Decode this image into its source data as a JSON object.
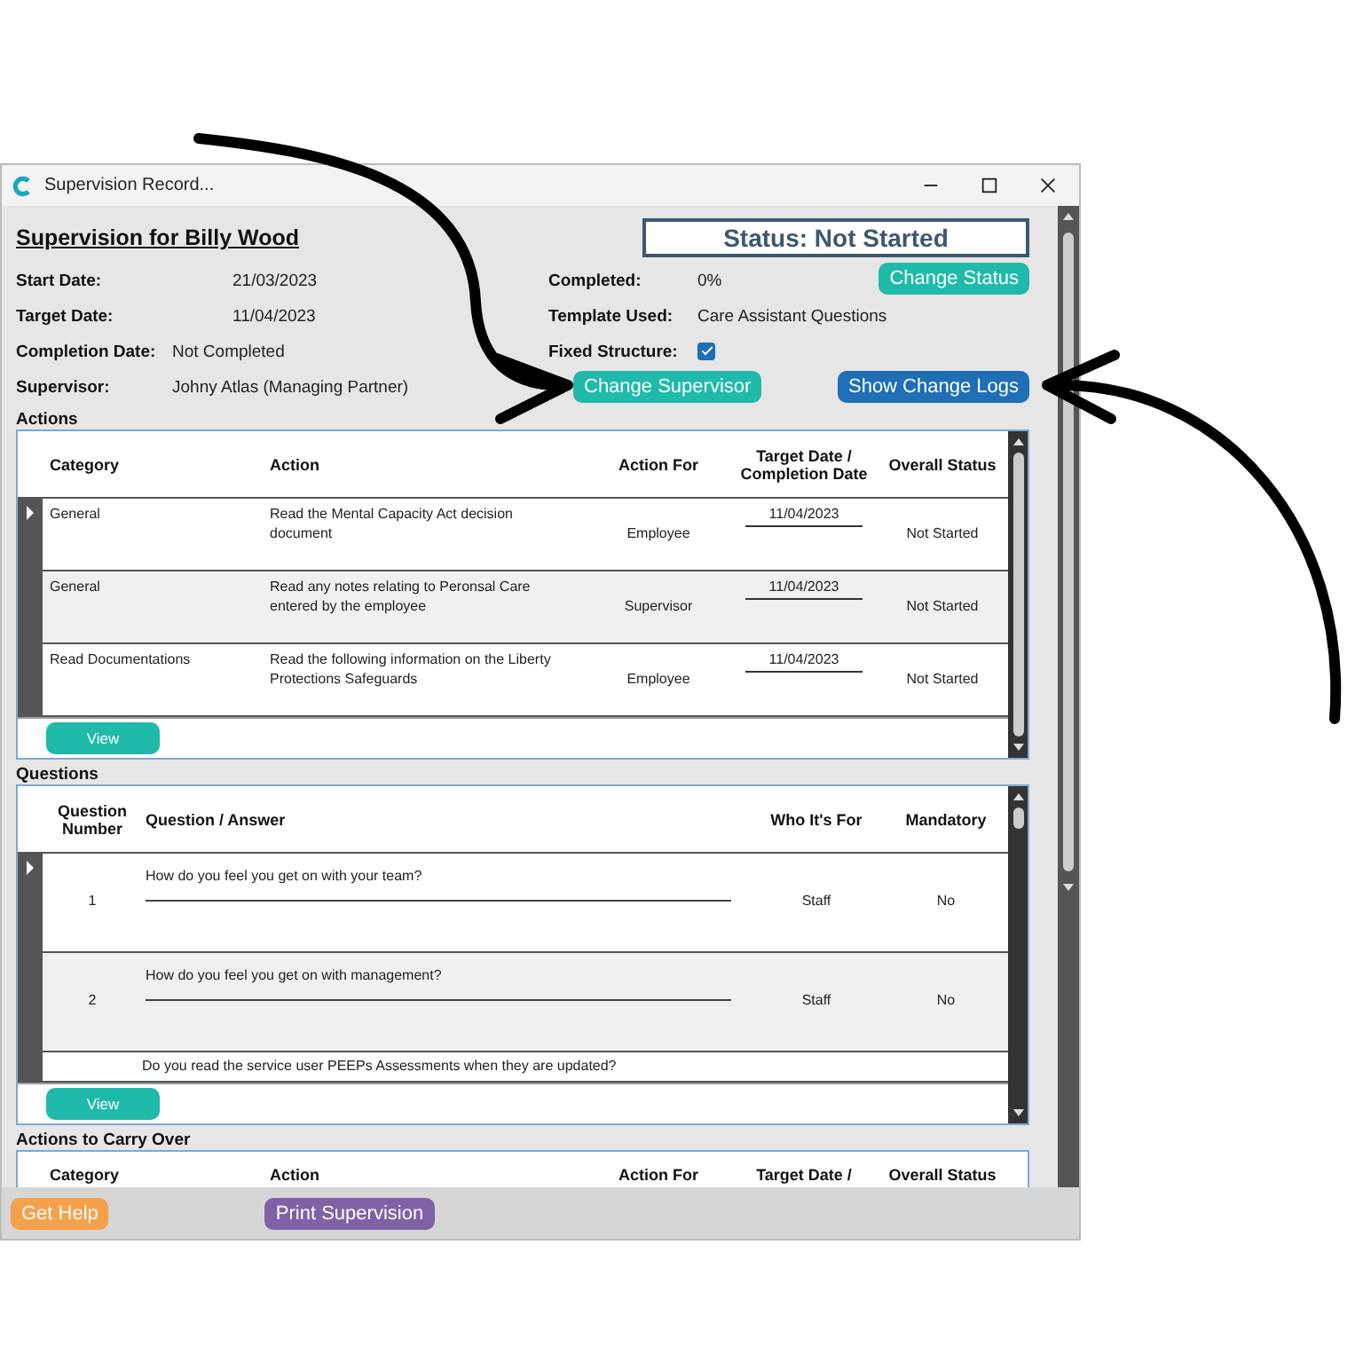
{
  "window": {
    "title": "Supervision Record..."
  },
  "heading": "Supervision for Billy Wood",
  "status_badge": "Status: Not Started",
  "left_fields": [
    {
      "label": "Start Date:",
      "value": "21/03/2023"
    },
    {
      "label": "Target Date:",
      "value": "11/04/2023"
    },
    {
      "label": "Completion Date:",
      "value": "Not Completed"
    },
    {
      "label": "Supervisor:",
      "value": "Johny Atlas (Managing Partner)"
    }
  ],
  "right_fields": [
    {
      "label": "Completed:",
      "kind": "text",
      "value": "0%"
    },
    {
      "label": "Template Used:",
      "kind": "text",
      "value": "Care Assistant Questions"
    },
    {
      "label": "Fixed Structure:",
      "kind": "checkbox",
      "checked": true
    }
  ],
  "buttons": {
    "change_status": "Change Status",
    "change_supervisor": "Change Supervisor",
    "show_change_logs": "Show Change Logs"
  },
  "actions": {
    "title": "Actions",
    "columns": [
      "Category",
      "Action",
      "Action For",
      "Target Date / Completion Date",
      "Overall Status"
    ],
    "rows": [
      {
        "selected": true,
        "cells": [
          "General",
          "Read the Mental Capacity Act decision document",
          "Employee",
          "11/04/2023",
          "Not Started"
        ]
      },
      {
        "selected": false,
        "cells": [
          "General",
          "Read any notes relating to Peronsal Care entered by the employee",
          "Supervisor",
          "11/04/2023",
          "Not Started"
        ]
      },
      {
        "selected": false,
        "cells": [
          "Read Documentations",
          "Read the following information on the Liberty Protections Safeguards",
          "Employee",
          "11/04/2023",
          "Not Started"
        ]
      }
    ],
    "view_button": "View"
  },
  "questions": {
    "title": "Questions",
    "columns": [
      "Question Number",
      "Question / Answer",
      "Who It's For",
      "Mandatory"
    ],
    "rows": [
      {
        "selected": true,
        "number": "1",
        "question": "How do you feel you get on with your team?",
        "who": "Staff",
        "mandatory": "No"
      },
      {
        "selected": false,
        "number": "2",
        "question": "How do you feel you get on with management?",
        "who": "Staff",
        "mandatory": "No"
      }
    ],
    "partial_row": "Do you read the service user PEEPs Assessments when they are updated?",
    "view_button": "View"
  },
  "carry_over": {
    "title": "Actions to Carry Over",
    "columns": [
      "Category",
      "Action",
      "Action For",
      "Target Date /",
      "Overall Status"
    ]
  },
  "footer": {
    "help": "Get Help",
    "print": "Print Supervision"
  }
}
